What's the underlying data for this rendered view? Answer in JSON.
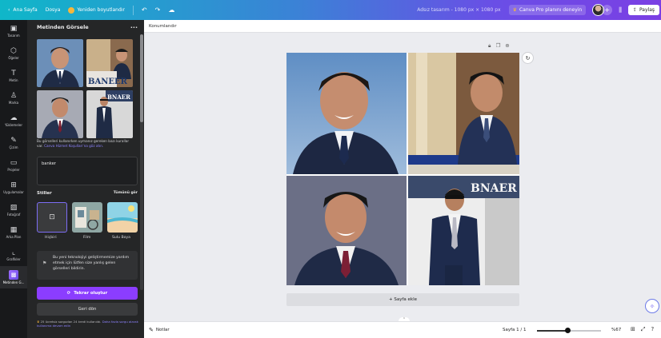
{
  "topbar": {
    "back_label": "Ana Sayfa",
    "file_label": "Dosya",
    "resize_label": "Yeniden boyutlandır",
    "undo_icon": "undo-icon",
    "redo_icon": "redo-icon",
    "cloud_icon": "cloud-sync-icon",
    "doc_title": "Adsız tasarım - 1080 px × 1080 px",
    "pro_label": "Canva Pro planını deneyin",
    "share_label": "Paylaş"
  },
  "rail": [
    {
      "label": "Tasarım",
      "icon": "▣"
    },
    {
      "label": "Öğeler",
      "icon": "⬡"
    },
    {
      "label": "Metin",
      "icon": "T"
    },
    {
      "label": "Marka",
      "icon": "♙"
    },
    {
      "label": "Yüklemeler",
      "icon": "☁"
    },
    {
      "label": "Çizim",
      "icon": "✎"
    },
    {
      "label": "Projeler",
      "icon": "▭"
    },
    {
      "label": "Uygulamalar",
      "icon": "⊞"
    },
    {
      "label": "Fotoğraf",
      "icon": "▨"
    },
    {
      "label": "Arka Plan",
      "icon": "▦"
    },
    {
      "label": "Grafikler",
      "icon": "⌞"
    },
    {
      "label": "Metinden G...",
      "icon": "▩"
    }
  ],
  "panel": {
    "title": "Metinden Görsele",
    "more_icon": "···",
    "thumb_banner_text_1": "BANEER",
    "thumb_banner_text_2": "BNAER",
    "description": "Bu görselleri kullanırken uymanız gereken bazı kurallar var.",
    "description_link": "Canva Hizmet Koşulları'na göz atın.",
    "prompt_value": "banker",
    "styles_title": "Stiller",
    "styles_all": "Tümünü gör",
    "styles": [
      {
        "label": "Hiçbiri"
      },
      {
        "label": "Film"
      },
      {
        "label": "Sulu Boya"
      }
    ],
    "note": "Bu yeni teknolojiyi geliştirmemize yardım etmek için lütfen size yanlış gelen görselleri bildirin.",
    "retry_label": "Tekrar oluştur",
    "back_label": "Geri dön",
    "credits_text": "25 ücretsiz sorgudan 24 kredi kullanıldı.",
    "credits_link": "Daha fazla sorgu alarak kullanıma devam edin"
  },
  "canvas": {
    "title_placeholder": "Konumlandır",
    "artboard_text_1": "BNAER",
    "add_page_label": "+ Sayfa ekle"
  },
  "bottombar": {
    "notes_label": "Notlar",
    "page_label": "Sayfa 1 / 1",
    "zoom_fraction": 0.48,
    "zoom_label": "%67"
  },
  "colors": {
    "accent": "#8b3dff",
    "panel_bg": "#252627",
    "rail_bg": "#18191b"
  }
}
